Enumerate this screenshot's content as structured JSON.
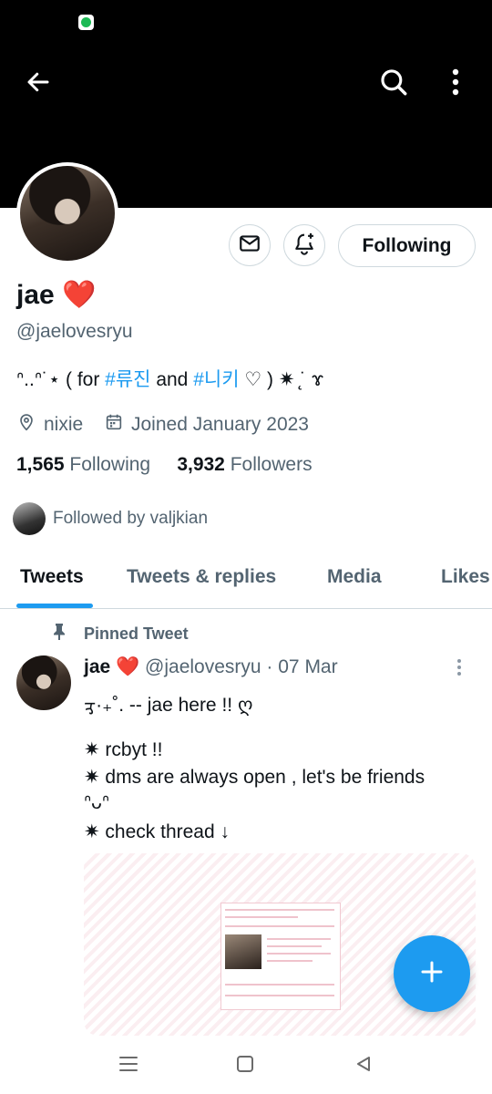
{
  "profile": {
    "name": "jae ❤️",
    "handle": "@jaelovesryu",
    "bio": {
      "prefix": "ᐢ..ᐢ˙⋆ ( for ",
      "tag1": "#류진",
      "middle": " and ",
      "tag2": "#니키",
      "suffix": " ♡ ) ✷ ̨˙ ɤ"
    },
    "location": "nixie",
    "joined": "Joined January 2023",
    "following_count": "1,565",
    "following_label": "Following",
    "followers_count": "3,932",
    "followers_label": "Followers",
    "followed_by": "Followed by valjkian",
    "follow_button_label": "Following"
  },
  "tabs": [
    {
      "label": "Tweets",
      "active": true
    },
    {
      "label": "Tweets & replies",
      "active": false
    },
    {
      "label": "Media",
      "active": false
    },
    {
      "label": "Likes",
      "active": false
    }
  ],
  "pinned_tweet": {
    "pinned_label": "Pinned Tweet",
    "author_name": "jae ❤️",
    "author_handle": "@jaelovesryu",
    "date": "· 07 Mar",
    "lines": [
      "ᢋ·₊˚. -- jae here !! ღ",
      "",
      "✷ rcbyt !!",
      "✷ dms are always open , let's be friends",
      "ᐢᴗᐢ",
      "✷ check thread ↓"
    ]
  },
  "colors": {
    "accent": "#1d9bf0",
    "text_primary": "#0f1419",
    "text_secondary": "#536471",
    "heart": "#e0245e",
    "border": "#cfd9de"
  },
  "icons": [
    "back-arrow-icon",
    "search-icon",
    "more-vertical-icon",
    "mail-icon",
    "bell-plus-icon",
    "location-icon",
    "calendar-icon",
    "pin-icon",
    "compose-plus-icon",
    "spotify-icon",
    "nav-menu-icon",
    "nav-home-icon",
    "nav-back-icon"
  ]
}
